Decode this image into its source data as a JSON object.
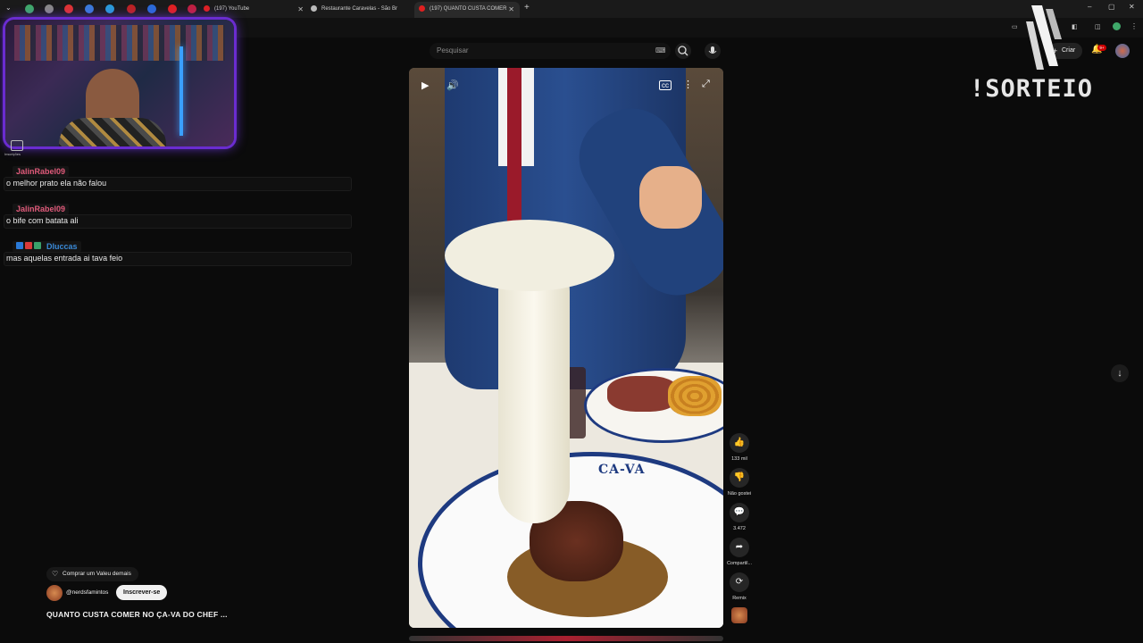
{
  "browser": {
    "tabs": [
      {
        "label": "(197) YouTube"
      },
      {
        "label": "Restaurante Caravelas - São Br"
      },
      {
        "label": "(197) QUANTO CUSTA COMER"
      }
    ],
    "new_tab": "+",
    "window_controls": {
      "minimize": "–",
      "maximize": "▢",
      "close": "✕"
    }
  },
  "header": {
    "search_placeholder": "Pesquisar",
    "create_label": "Criar",
    "notification_count": "9+"
  },
  "sidebar": {
    "subscriptions_label": "Inscrições"
  },
  "chat": [
    {
      "user": "JalinRabel09",
      "message": "o melhor prato ela não falou",
      "user_color": "#e05a7a"
    },
    {
      "user": "JalinRabel09",
      "message": "o bife com batata ali",
      "user_color": "#e05a7a"
    },
    {
      "user": "Dluccas",
      "message": "mas aquelas entrada ai tava feio",
      "user_color": "#3a8ad8"
    }
  ],
  "video": {
    "plate_text": "CA-VA"
  },
  "actions": {
    "like_count": "133 mil",
    "dislike_label": "Não gostei",
    "comment_count": "3.472",
    "share_label": "Compartil...",
    "remix_label": "Remix"
  },
  "channel": {
    "buy_label": "Comprar um Valeu demais",
    "name": "@nerdsfamintos",
    "subscribe_label": "Inscrever-se",
    "video_title": "QUANTO CUSTA COMER NO ÇA-VA DO CHEF ..."
  },
  "overlay": {
    "sorteio_text": "!SORTEIO"
  },
  "colors": {
    "youtube_red": "#cc0000",
    "webcam_glow": "#7b3cff",
    "plate_blue": "#1e3a80"
  }
}
